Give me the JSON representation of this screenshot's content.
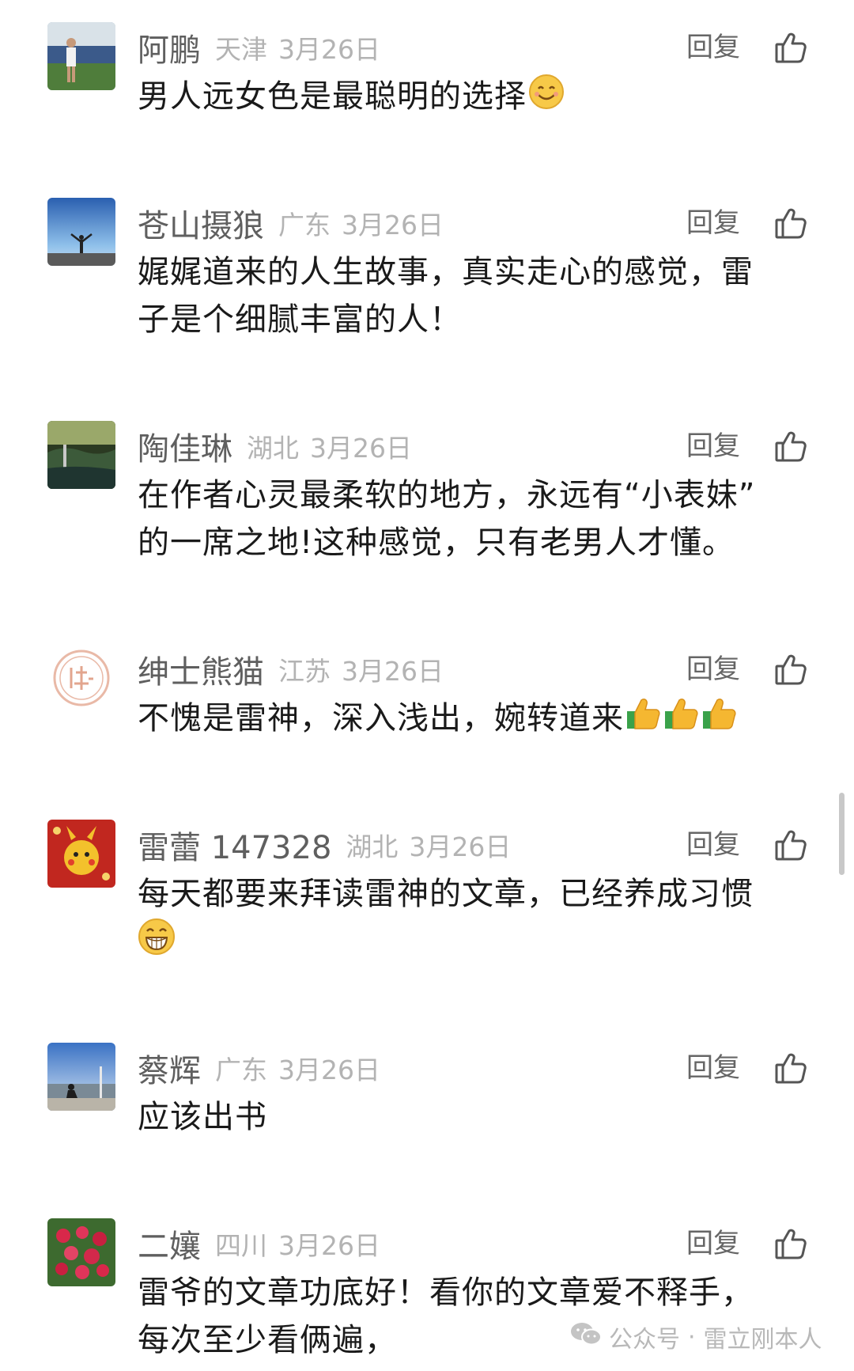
{
  "comments": [
    {
      "name": "阿鹏",
      "location": "天津",
      "date": "3月26日",
      "reply_label": "回复",
      "text": "男人远女色是最聪明的选择",
      "emoji": [
        "smiling-face"
      ]
    },
    {
      "name": "苍山摄狼",
      "location": "广东",
      "date": "3月26日",
      "reply_label": "回复",
      "text_lines": [
        "娓娓道来的人生故事，真实走心的感觉，雷",
        "子是个细腻丰富的人！"
      ]
    },
    {
      "name": "陶佳琳",
      "location": "湖北",
      "date": "3月26日",
      "reply_label": "回复",
      "text_lines": [
        "在作者心灵最柔软的地方，永远有“小表妹”",
        "的一席之地!这种感觉，只有老男人才懂。"
      ]
    },
    {
      "name": "绅士熊猫",
      "location": "江苏",
      "date": "3月26日",
      "reply_label": "回复",
      "text": "不愧是雷神，深入浅出，婉转道来",
      "emoji": [
        "thumbs-up",
        "thumbs-up",
        "thumbs-up"
      ]
    },
    {
      "name": "雷蕾 147328",
      "location": "湖北",
      "date": "3月26日",
      "reply_label": "回复",
      "text": "每天都要来拜读雷神的文章，已经养成习惯",
      "emoji": [
        "grinning-face"
      ]
    },
    {
      "name": "蔡辉",
      "location": "广东",
      "date": "3月26日",
      "reply_label": "回复",
      "text": "应该出书"
    },
    {
      "name": "二孃",
      "location": "四川",
      "date": "3月26日",
      "reply_label": "回复",
      "text_lines": [
        "雷爷的文章功底好！看你的文章爱不释手，",
        "每次至少看俩遍，"
      ]
    }
  ],
  "watermark": {
    "platform": "公众号",
    "separator": "·",
    "account": "雷立刚本人",
    "icon": "wechat-icon"
  },
  "colors": {
    "name": "#5f5f5f",
    "meta": "#b3b3b3",
    "text": "#1a1a1a",
    "reply": "#666666"
  }
}
